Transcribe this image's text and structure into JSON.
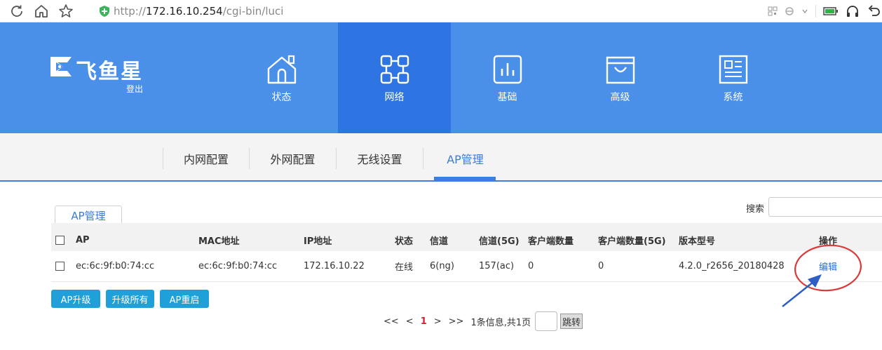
{
  "browser": {
    "url_proto": "http://",
    "url_host": "172.16.10.254",
    "url_path": "/cgi-bin/luci"
  },
  "header": {
    "logo_text": "飞鱼星",
    "logout_label": "登出",
    "nav": [
      {
        "label": "状态",
        "icon": "house-icon"
      },
      {
        "label": "网络",
        "icon": "network-icon"
      },
      {
        "label": "基础",
        "icon": "bar-chart-icon"
      },
      {
        "label": "高级",
        "icon": "bag-icon"
      },
      {
        "label": "系统",
        "icon": "document-icon"
      }
    ],
    "active_nav": "网络"
  },
  "subnav": {
    "tabs": [
      "内网配置",
      "外网配置",
      "无线设置",
      "AP管理"
    ],
    "active": "AP管理"
  },
  "content": {
    "tab_label": "AP管理",
    "search_label": "搜索",
    "columns": [
      "AP",
      "MAC地址",
      "IP地址",
      "状态",
      "信道",
      "信道(5G)",
      "客户端数量",
      "客户端数量(5G)",
      "版本型号",
      "操作"
    ],
    "rows": [
      {
        "ap": "ec:6c:9f:b0:74:cc",
        "mac": "ec:6c:9f:b0:74:cc",
        "ip": "172.16.10.22",
        "status": "在线",
        "channel": "6(ng)",
        "channel5g": "157(ac)",
        "clients": "0",
        "clients5g": "0",
        "version": "4.2.0_r2656_20180428",
        "action": "编辑"
      }
    ],
    "buttons": {
      "upgrade": "AP升级",
      "upgrade_all": "升级所有",
      "reboot": "AP重启"
    },
    "pager": {
      "first": "<<",
      "prev": "<",
      "current": "1",
      "next": ">",
      "last": ">>",
      "info": "1条信息,共1页",
      "go_label": "跳转"
    }
  },
  "colors": {
    "header_bg": "#4a8fe8",
    "header_active": "#2f74e3",
    "accent": "#3a7ae0",
    "button": "#1fa0d8",
    "annotation_red": "#d93a3a",
    "annotation_arrow": "#2f5fc4"
  }
}
